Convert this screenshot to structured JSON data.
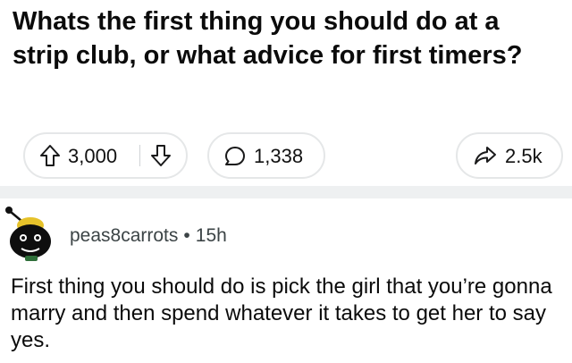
{
  "post": {
    "title": "Whats the first thing you should do at a strip club, or what advice for first timers?",
    "vote_count": "3,000",
    "comment_count": "1,338",
    "share_count": "2.5k",
    "icons": {
      "upvote": "upvote-arrow-icon",
      "downvote": "downvote-arrow-icon",
      "comment": "comment-bubble-icon",
      "share": "share-arrow-icon"
    }
  },
  "comment": {
    "author": "peas8carrots",
    "separator": "•",
    "time": "15h",
    "body": "First thing you should do is pick the girl that you’re gonna marry and then spend whatever it takes to get her to say yes."
  },
  "colors": {
    "text": "#0b0b0b",
    "muted": "#3c4446",
    "pill_border": "#e5e7e8",
    "separator": "#eef0f1"
  }
}
